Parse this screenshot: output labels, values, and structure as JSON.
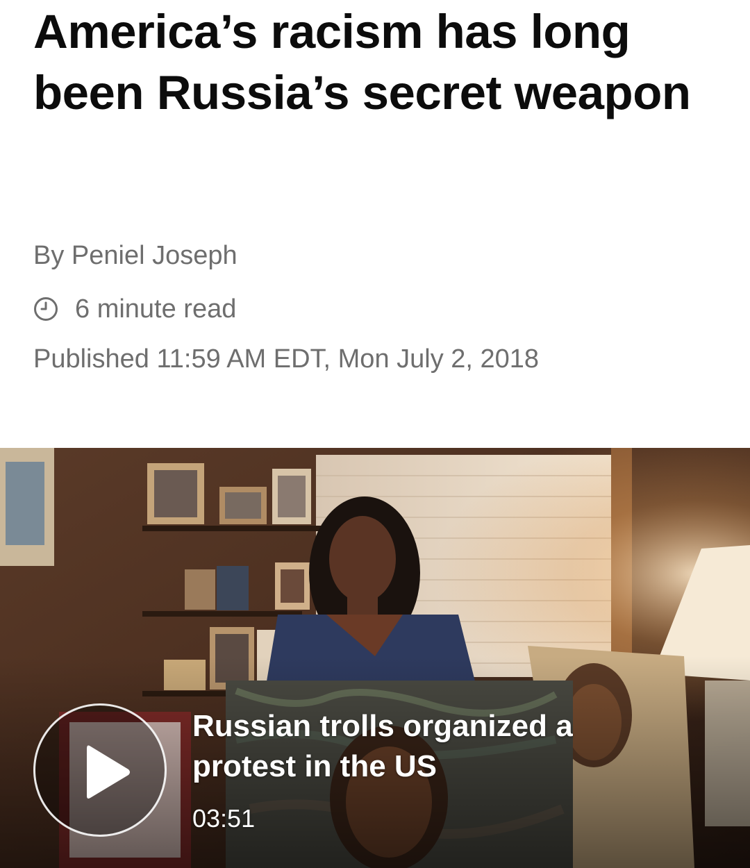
{
  "article": {
    "headline": "America’s racism has long been Russia’s secret weapon",
    "byline": "By Peniel Joseph",
    "read_time": "6 minute read",
    "published": "Published 11:59 AM EDT, Mon July 2, 2018"
  },
  "video": {
    "title": "Russian trolls organized a protest in the US",
    "duration": "03:51",
    "play_icon": "play-icon"
  },
  "icons": {
    "read_time_icon": "clock-icon"
  },
  "colors": {
    "headline": "#0c0c0c",
    "meta_text": "#6e6e6e",
    "overlay_text": "#ffffff"
  }
}
